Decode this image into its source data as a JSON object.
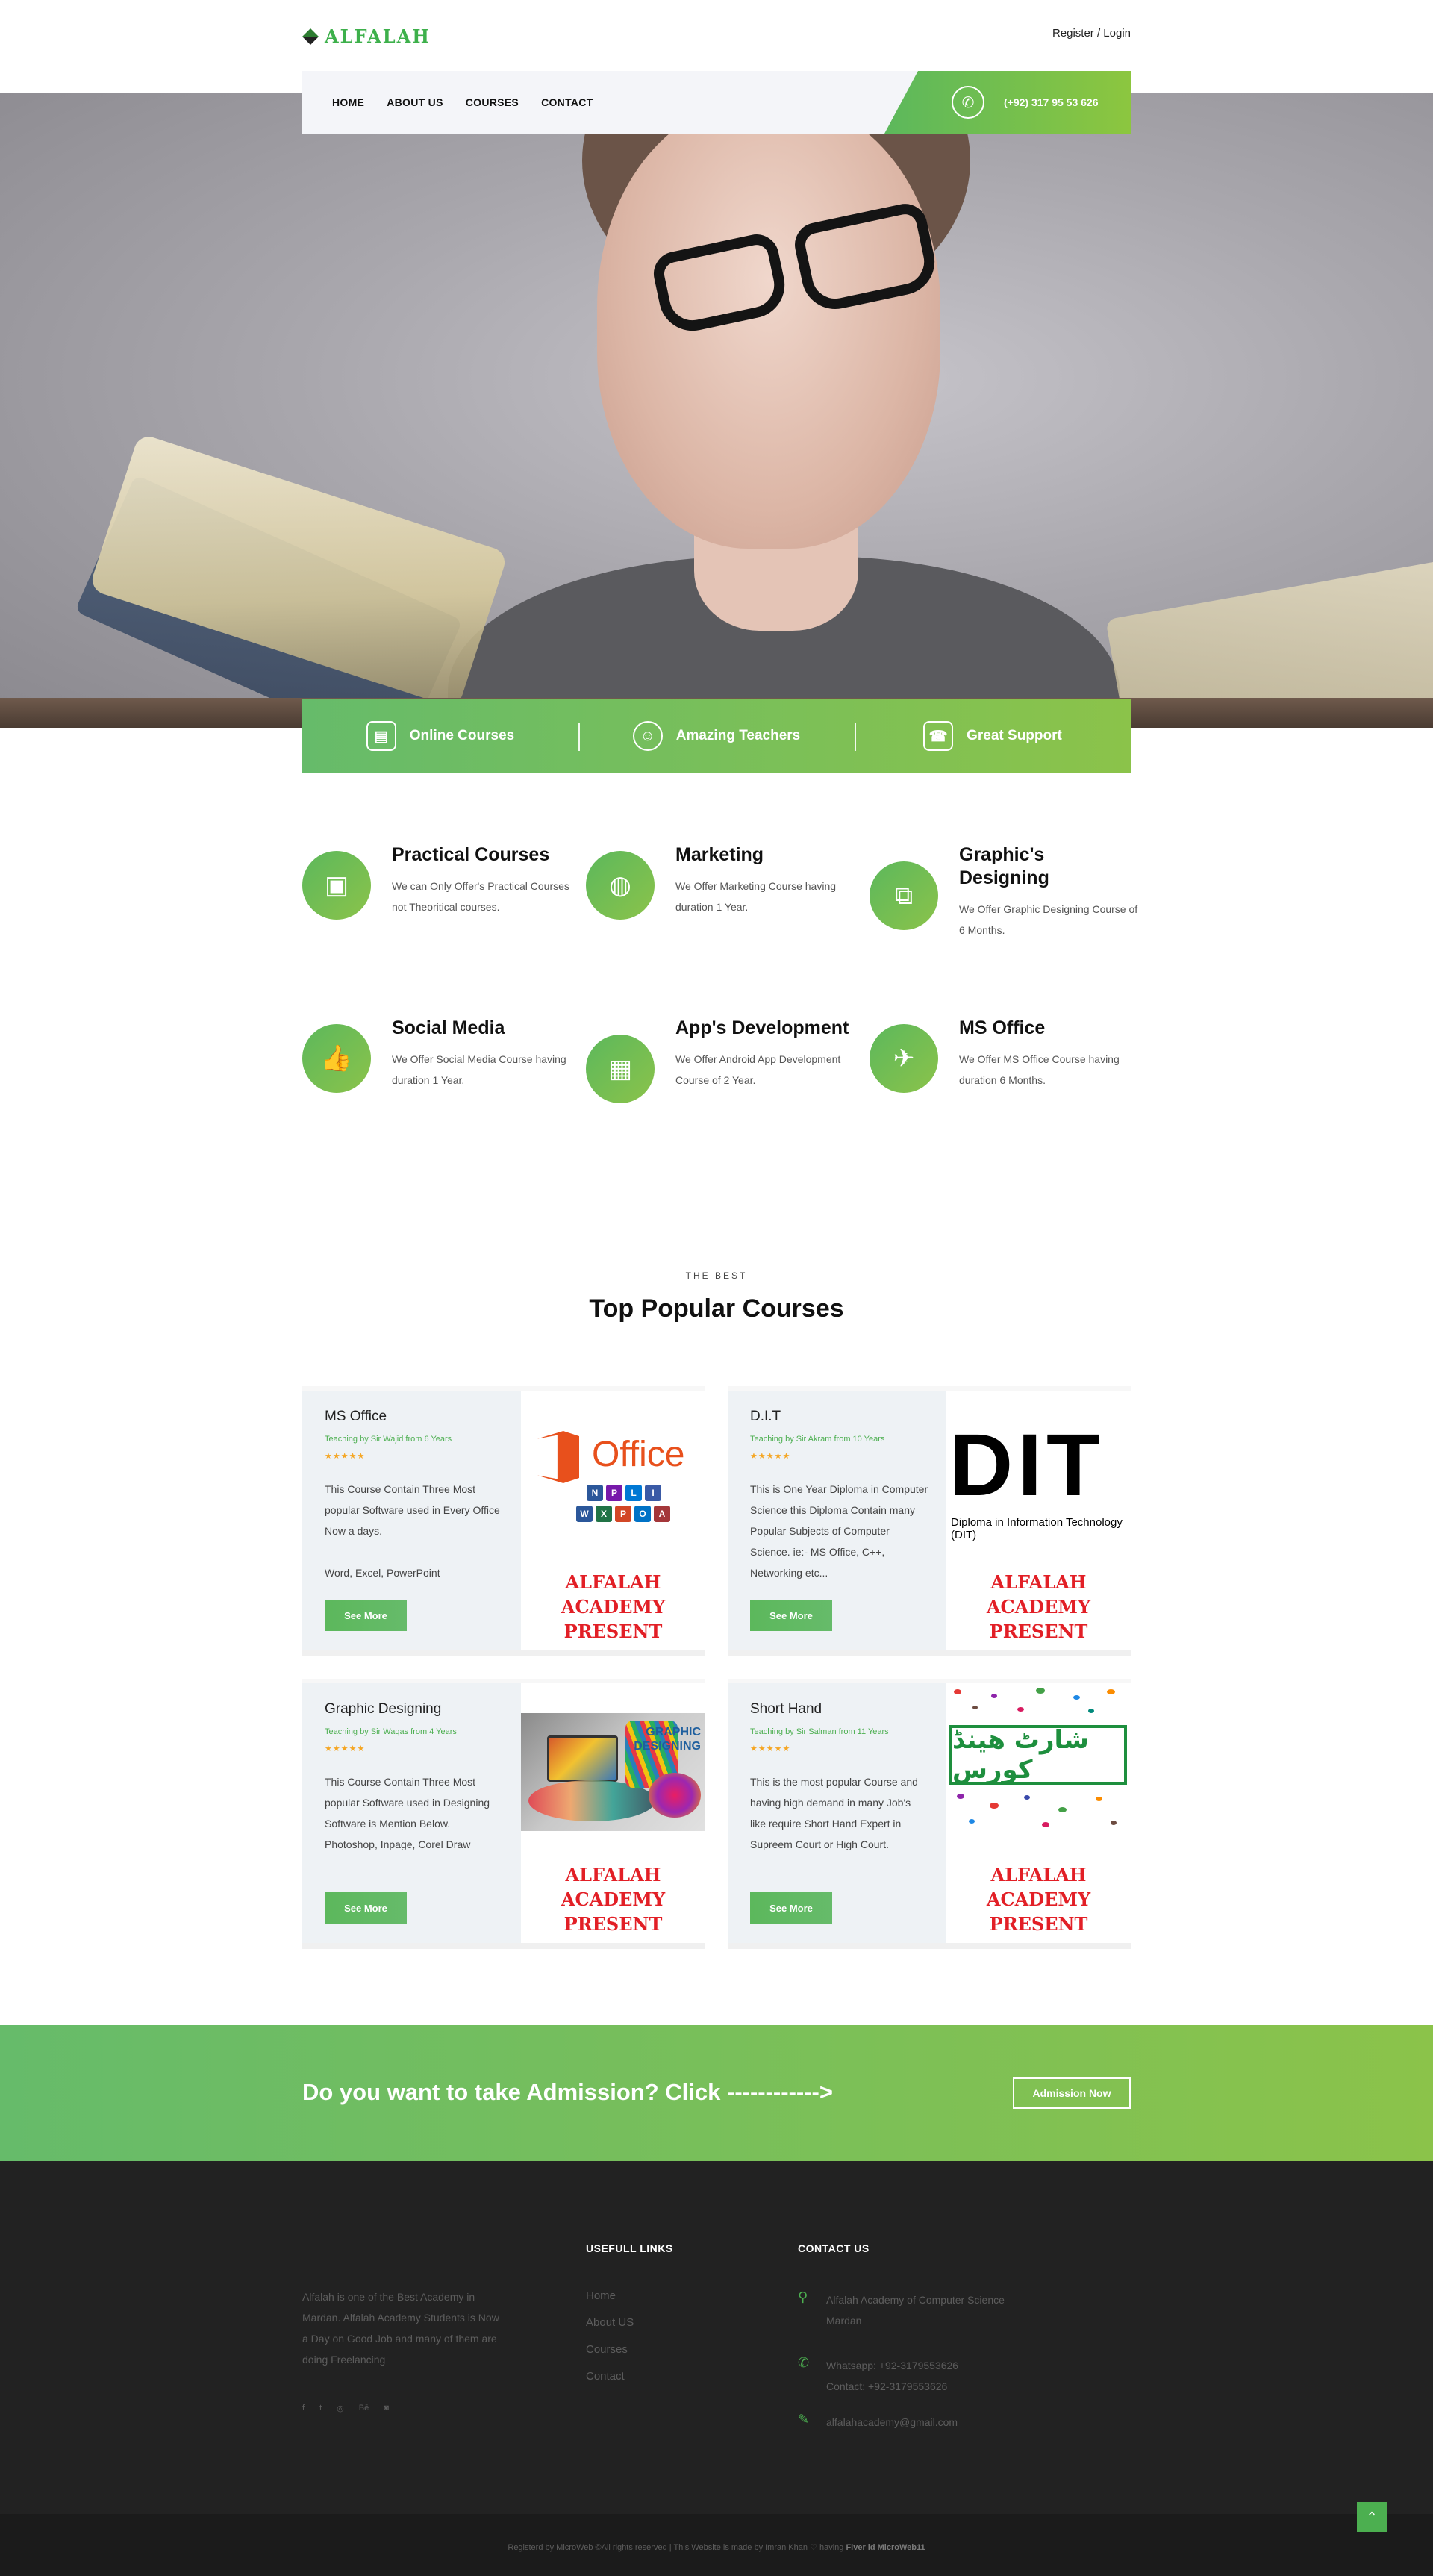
{
  "brand": {
    "name": "ALFALAH"
  },
  "header": {
    "auth_link": "Register / Login"
  },
  "nav": {
    "items": [
      "HOME",
      "ABOUT US",
      "COURSES",
      "CONTACT"
    ],
    "phone": "(+92) 317 95 53 626"
  },
  "features": [
    {
      "label": "Online Courses",
      "icon": "certificate-icon"
    },
    {
      "label": "Amazing Teachers",
      "icon": "teacher-icon"
    },
    {
      "label": "Great Support",
      "icon": "telephone-icon"
    }
  ],
  "services": [
    {
      "title": "Practical Courses",
      "desc": "We can Only Offer's Practical Courses not Theoritical courses.",
      "icon": "id-card-icon"
    },
    {
      "title": "Marketing",
      "desc": "We Offer Marketing Course having duration 1 Year.",
      "icon": "globe-icon"
    },
    {
      "title": "Graphic's Designing",
      "desc": "We Offer Graphic Designing Course of 6 Months.",
      "icon": "map-icon"
    },
    {
      "title": "Social Media",
      "desc": "We Offer Social Media Course having duration 1 Year.",
      "icon": "thumbs-up-icon"
    },
    {
      "title": "App's Development",
      "desc": "We Offer Android App Development Course of 2 Year.",
      "icon": "newspaper-icon"
    },
    {
      "title": "MS Office",
      "desc": "We Offer MS Office Course having duration 6 Months.",
      "icon": "paper-plane-icon"
    }
  ],
  "popular": {
    "label": "THE BEST",
    "title": "Top Popular Courses",
    "image_caption_1": "ALFALAH ACADEMY",
    "image_caption_2": "PRESENT",
    "courses": [
      {
        "title": "MS Office",
        "teacher": "Teaching by Sir Wajid from 6 Years",
        "stars": "★★★★★",
        "desc": "This Course Contain Three Most popular Software used in Every Office Now a days.",
        "desc2": "Word, Excel, PowerPoint",
        "button": "See More"
      },
      {
        "title": "D.I.T",
        "teacher": "Teaching by Sir Akram from 10 Years",
        "stars": "★★★★★",
        "desc": "This is One Year Diploma in Computer Science this Diploma Contain many Popular Subjects of Computer Science. ie:- MS Office, C++, Networking etc...",
        "desc2": "",
        "button": "See More"
      },
      {
        "title": "Graphic Designing",
        "teacher": "Teaching by Sir Waqas from 4 Years",
        "stars": "★★★★★",
        "desc": "This Course Contain Three Most popular Software used in Designing Software is Mention Below.",
        "desc2": "Photoshop, Inpage, Corel Draw",
        "button": "See More"
      },
      {
        "title": "Short Hand",
        "teacher": "Teaching by Sir Salman from 11 Years",
        "stars": "★★★★★",
        "desc": "This is the most popular Course and having high demand in many Job's like require Short Hand Expert in Supreem Court or High Court.",
        "desc2": "",
        "button": "See More"
      }
    ],
    "office_image": {
      "word": "Office",
      "tiles_top": [
        "N",
        "P",
        "L",
        "I"
      ],
      "tiles_bottom": [
        "W",
        "X",
        "P",
        "O",
        "A"
      ]
    },
    "dit_image": {
      "word": "DIT",
      "sub": "Diploma in Information Technology (DIT)"
    },
    "graphic_image": {
      "word1": "GRAPHIC",
      "word2": "DESIGNING"
    },
    "shorthand_image": {
      "word": "شارٹ ھینڈ کورس"
    }
  },
  "cta": {
    "text": "Do you want to take Admission? Click ------------>",
    "button": "Admission Now"
  },
  "footer": {
    "about": "Alfalah is one of the Best Academy in Mardan. Alfalah Academy Students is Now a Day on Good Job and many of them are doing Freelancing",
    "social": [
      "f",
      "t",
      "◎",
      "Bē",
      "◙"
    ],
    "links_heading": "USEFULL LINKS",
    "links": [
      "Home",
      "About US",
      "Courses",
      "Contact"
    ],
    "contact_heading": "CONTACT US",
    "address_1": "Alfalah Academy of Computer Science",
    "address_2": "Mardan",
    "whatsapp": "Whatsapp: +92-3179553626",
    "contact": "Contact: +92-3179553626",
    "email": "alfalahacademy@gmail.com",
    "copyright_prefix": "Registerd by MicroWeb ©All rights reserved | This Website is made by Imran Khan ♡ having",
    "copyright_bold": "Fiver id MicroWeb11"
  },
  "colors": {
    "accent": "#5cb85c",
    "accent_light": "#8bc34a",
    "footer_bg": "#222222"
  }
}
